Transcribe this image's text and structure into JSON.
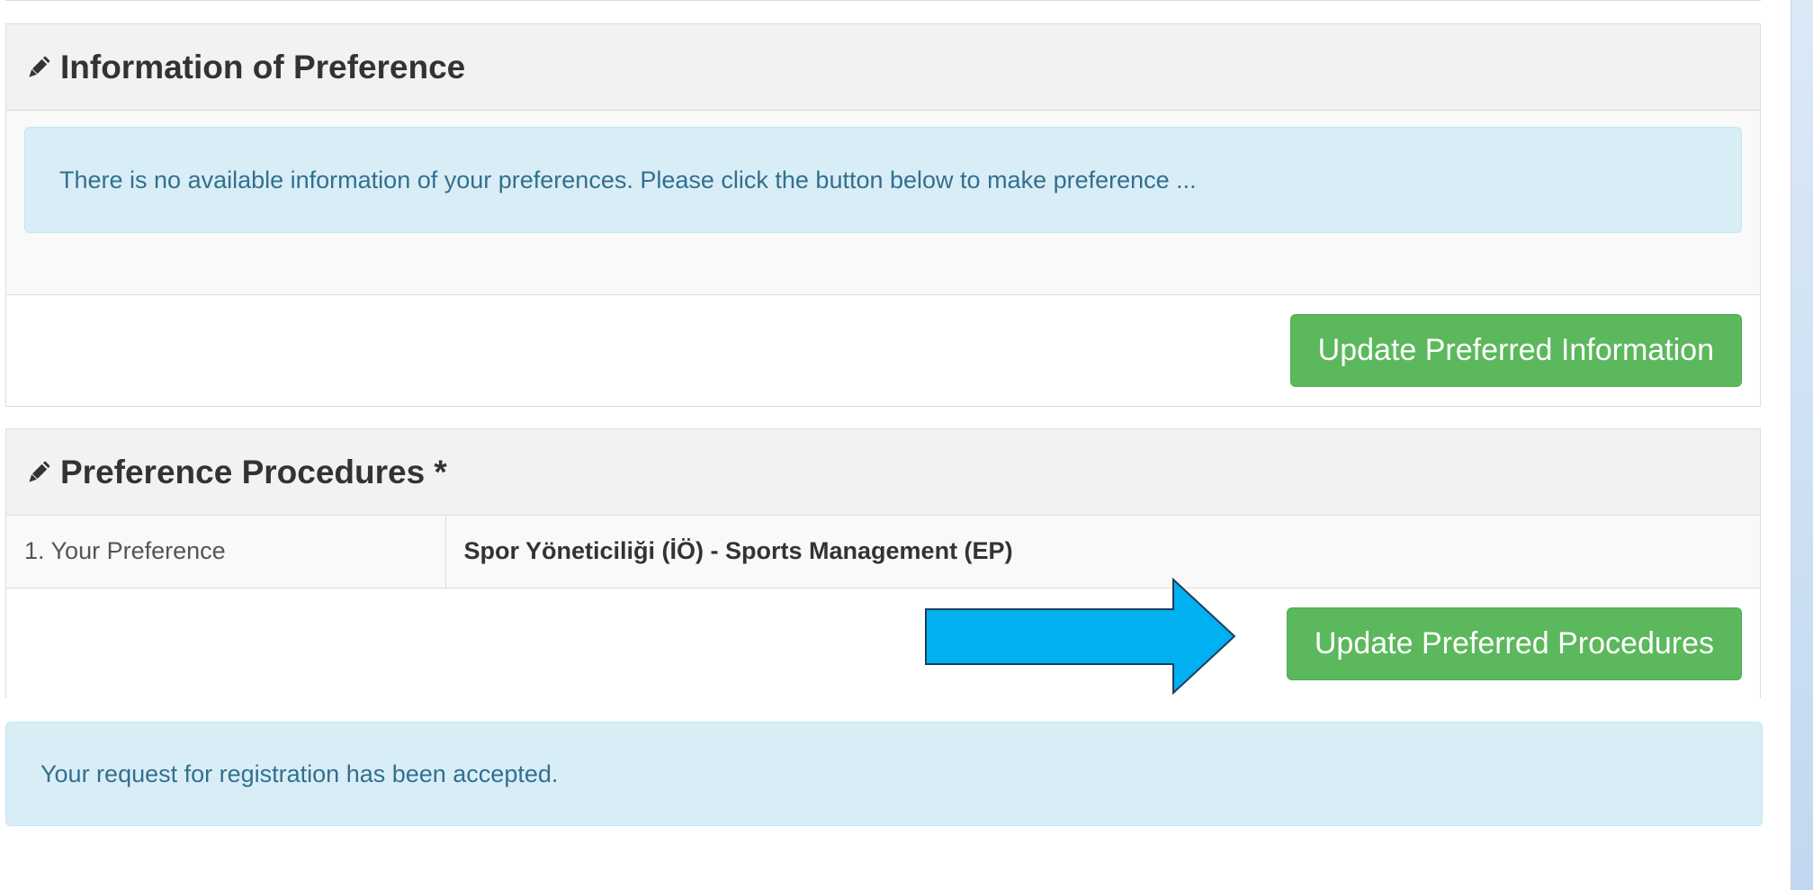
{
  "panel_preference_info": {
    "title": "Information of Preference",
    "icon": "pencil-icon",
    "message": "There is no available information of your preferences. Please click the button below to make preference ...",
    "button_label": "Update Preferred Information"
  },
  "panel_procedures": {
    "title": "Preference Procedures *",
    "icon": "pencil-icon",
    "rows": [
      {
        "label": "1. Your Preference",
        "value": "Spor Yöneticiliği (İÖ) - Sports Management (EP)"
      }
    ],
    "button_label": "Update Preferred Procedures"
  },
  "status_message": "Your request for registration has been accepted.",
  "colors": {
    "button_green": "#5cb85c",
    "alert_bg": "#d9edf7",
    "alert_text": "#31708f",
    "arrow_fill": "#00b0f0"
  }
}
